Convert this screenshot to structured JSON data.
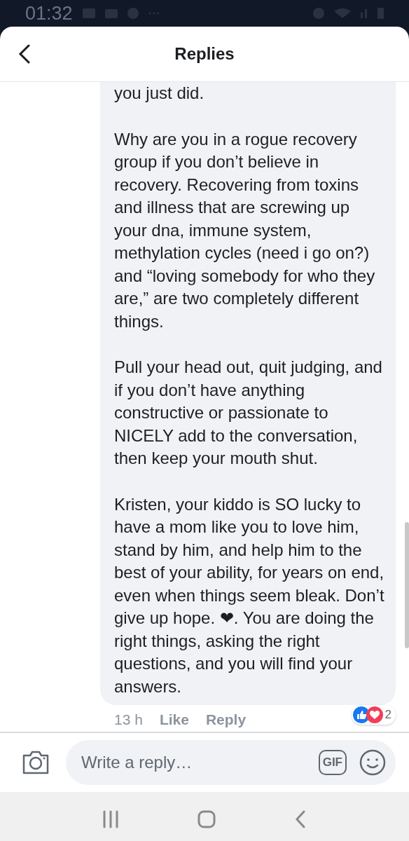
{
  "status_bar": {
    "time": "01:32"
  },
  "header": {
    "title": "Replies"
  },
  "comment": {
    "paragraphs": [
      {
        "text": "you just did."
      },
      {
        "text": "Why are you in a rogue recovery group if you don’t believe in recovery. Recovering from toxins and illness that are screwing up your dna, immune system, methylation cycles (need i go on?) and “loving somebody for who they are,” are two completely different things."
      },
      {
        "text": "Pull your head out, quit judging, and if you don’t have anything constructive or passionate to NICELY add to the conversation, then keep your mouth shut."
      },
      {
        "text": "Kristen, your kiddo is SO lucky to have a mom like you to love him, stand by him, and help him to the best of your ability, for years on end, even when things seem bleak. Don’t give up hope. ❤. You are doing the right things, asking the right questions, and you will find your answers."
      }
    ],
    "time": "13 h",
    "like": "Like",
    "reply": "Reply",
    "reaction_count": "2"
  },
  "composer": {
    "placeholder": "Write a reply…",
    "gif": "GIF"
  }
}
